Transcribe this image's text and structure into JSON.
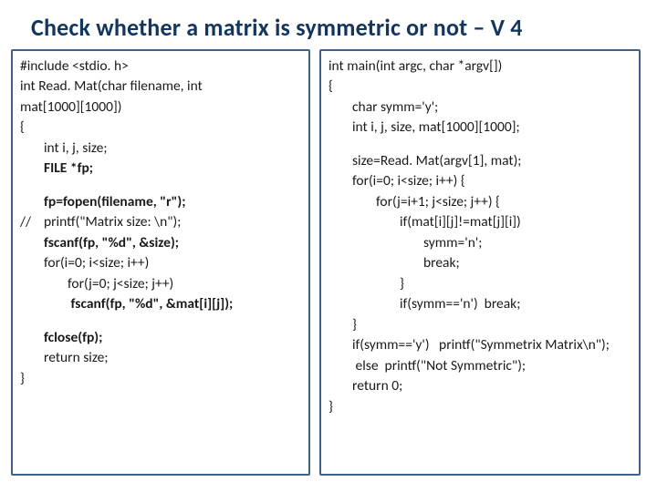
{
  "title": "Check whether a matrix is symmetric or not – V 4",
  "left": {
    "l0": "#include <stdio. h>",
    "l1a": "int Read. Mat(char filename, int",
    "l1b": "mat[1000][1000])",
    "l2": "{",
    "l3": "int i, j, size;",
    "l4": "FILE *fp;",
    "l5": "fp=fopen(filename, \"r\");",
    "comment": "//",
    "l6": "printf(\"Matrix size: \\n\");",
    "l7": "fscanf(fp, \"%d\", &size);",
    "l8": "for(i=0; i<size; i++)",
    "l9": "for(j=0; j<size; j++)",
    "l10": " fscanf(fp, \"%d\", &mat[i][j]);",
    "l11": "fclose(fp);",
    "l12": "return size;",
    "l13": "}"
  },
  "right": {
    "r0": "int main(int argc, char *argv[])",
    "r1": "{",
    "r2": "char symm='y';",
    "r3": "int i, j, size, mat[1000][1000];",
    "r4": "size=Read. Mat(argv[1], mat);",
    "r5": "for(i=0; i<size; i++) {",
    "r6": "for(j=i+1; j<size; j++) {",
    "r7": "if(mat[i][j]!=mat[j][i])",
    "r8": "symm='n';",
    "r9": "break;",
    "r10": "}",
    "r11": "if(symm=='n')  break;",
    "r12": "}",
    "r13": "if(symm=='y')   printf(\"Symmetrix Matrix\\n\");",
    "r14": " else  printf(\"Not Symmetric\");",
    "r15": "return 0;",
    "r16": "}"
  }
}
